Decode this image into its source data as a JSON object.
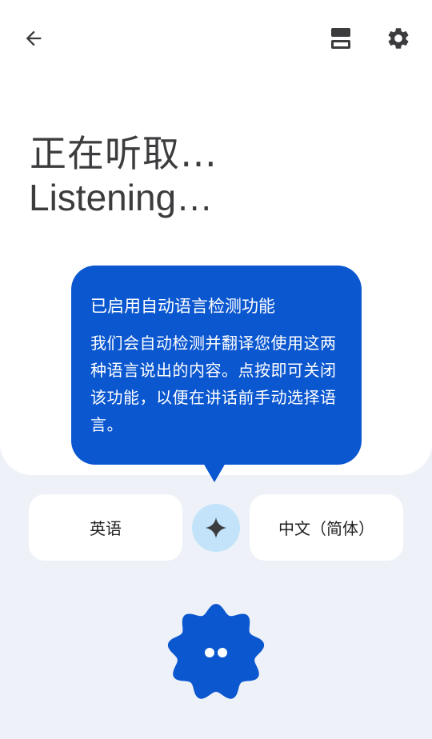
{
  "header": {
    "back_icon": "arrow-back-icon",
    "layout_icon": "dual-screen-layout-icon",
    "settings_icon": "gear-icon"
  },
  "status": {
    "primary": "正在听取…",
    "secondary": "Listening…"
  },
  "tooltip": {
    "title": "已启用自动语言检测功能",
    "body": "我们会自动检测并翻译您使用这两种语言说出的内容。点按即可关闭该功能，以便在讲话前手动选择语言。"
  },
  "languages": {
    "source": "英语",
    "target": "中文（简体）",
    "auto_detect_icon": "sparkle-icon"
  },
  "mic": {
    "icon": "listening-dots-icon"
  },
  "colors": {
    "accent": "#0b57d0",
    "swap_bg": "#c3e3fb",
    "background": "#eef2f8",
    "card": "#ffffff",
    "text": "#3c3c3f"
  }
}
